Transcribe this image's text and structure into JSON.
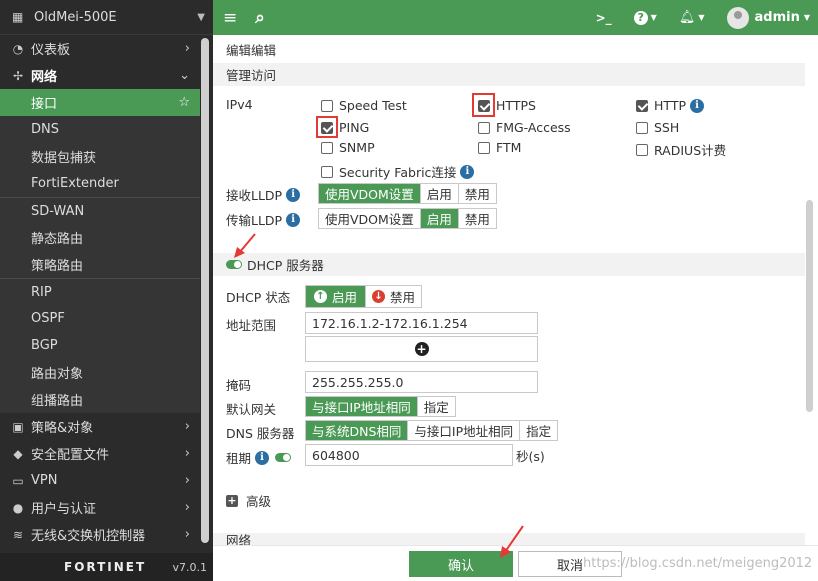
{
  "sidebar": {
    "device_name": "OldMei-500E",
    "items": [
      {
        "label": "仪表板",
        "icon": "dashboard-icon",
        "glyph": "◔",
        "chev": "›",
        "type": "top"
      },
      {
        "label": "网络",
        "icon": "network-icon",
        "glyph": "✢",
        "chev": "⌄",
        "type": "top-bold"
      },
      {
        "label": "接口",
        "type": "sub-active",
        "star": "☆"
      },
      {
        "label": "DNS",
        "type": "sub"
      },
      {
        "label": "数据包捕获",
        "type": "sub"
      },
      {
        "label": "FortiExtender",
        "type": "sub"
      },
      {
        "label": "SD-WAN",
        "type": "sub-sep"
      },
      {
        "label": "静态路由",
        "type": "sub"
      },
      {
        "label": "策略路由",
        "type": "sub"
      },
      {
        "label": "RIP",
        "type": "sub-sep"
      },
      {
        "label": "OSPF",
        "type": "sub"
      },
      {
        "label": "BGP",
        "type": "sub"
      },
      {
        "label": "路由对象",
        "type": "sub"
      },
      {
        "label": "组播路由",
        "type": "sub"
      },
      {
        "label": "策略&对象",
        "icon": "policy-icon",
        "glyph": "▣",
        "chev": "›",
        "type": "top"
      },
      {
        "label": "安全配置文件",
        "icon": "security-profile-icon",
        "glyph": "◆",
        "chev": "›",
        "type": "top"
      },
      {
        "label": "VPN",
        "icon": "vpn-icon",
        "glyph": "▭",
        "chev": "›",
        "type": "top"
      },
      {
        "label": "用户与认证",
        "icon": "user-icon",
        "glyph": "●",
        "chev": "›",
        "type": "top"
      },
      {
        "label": "无线&交换机控制器",
        "icon": "wifi-icon",
        "glyph": "≋",
        "chev": "›",
        "type": "top"
      }
    ],
    "footer_logo": "FORTINET",
    "version": "v7.0.1"
  },
  "topbar": {
    "menu_glyph": "≡",
    "search_glyph": "⌕",
    "cli_glyph": ">_",
    "help_glyph": "?",
    "bell_glyph": "♫",
    "user": "admin"
  },
  "main": {
    "top_title": "编辑编辑",
    "admin_access_section": "管理访问",
    "ipv4_label": "IPv4",
    "access_options": [
      {
        "label": "Speed Test",
        "checked": false
      },
      {
        "label": "HTTPS",
        "checked": true
      },
      {
        "label": "HTTP",
        "checked": true
      },
      {
        "label": "PING",
        "checked": true
      },
      {
        "label": "FMG-Access",
        "checked": false
      },
      {
        "label": "SSH",
        "checked": false
      },
      {
        "label": "SNMP",
        "checked": false
      },
      {
        "label": "FTM",
        "checked": false
      },
      {
        "label": "RADIUS计费",
        "checked": false
      },
      {
        "label": "Security Fabric连接",
        "checked": false
      }
    ],
    "receive_lldp": {
      "label": "接收LLDP",
      "options": [
        "使用VDOM设置",
        "启用",
        "禁用"
      ],
      "selected": 0
    },
    "transmit_lldp": {
      "label": "传输LLDP",
      "options": [
        "使用VDOM设置",
        "启用",
        "禁用"
      ],
      "selected": 1
    },
    "dhcp_section": "DHCP 服务器",
    "dhcp_status": {
      "label": "DHCP 状态",
      "enable": "启用",
      "disable": "禁用"
    },
    "address_range": {
      "label": "地址范围",
      "value": "172.16.1.2-172.16.1.254",
      "add_glyph": "+"
    },
    "netmask": {
      "label": "掩码",
      "value": "255.255.255.0"
    },
    "gateway": {
      "label": "默认网关",
      "options": [
        "与接口IP地址相同",
        "指定"
      ],
      "selected": 0
    },
    "dns": {
      "label": "DNS 服务器",
      "options": [
        "与系统DNS相同",
        "与接口IP地址相同",
        "指定"
      ],
      "selected": 0
    },
    "lease": {
      "label": "租期",
      "value": "604800",
      "unit": "秒(s)"
    },
    "advanced": "高级",
    "network_section": "网络"
  },
  "footer": {
    "ok": "确认",
    "cancel": "取消",
    "watermark": "https://blog.csdn.net/meigeng2012"
  }
}
